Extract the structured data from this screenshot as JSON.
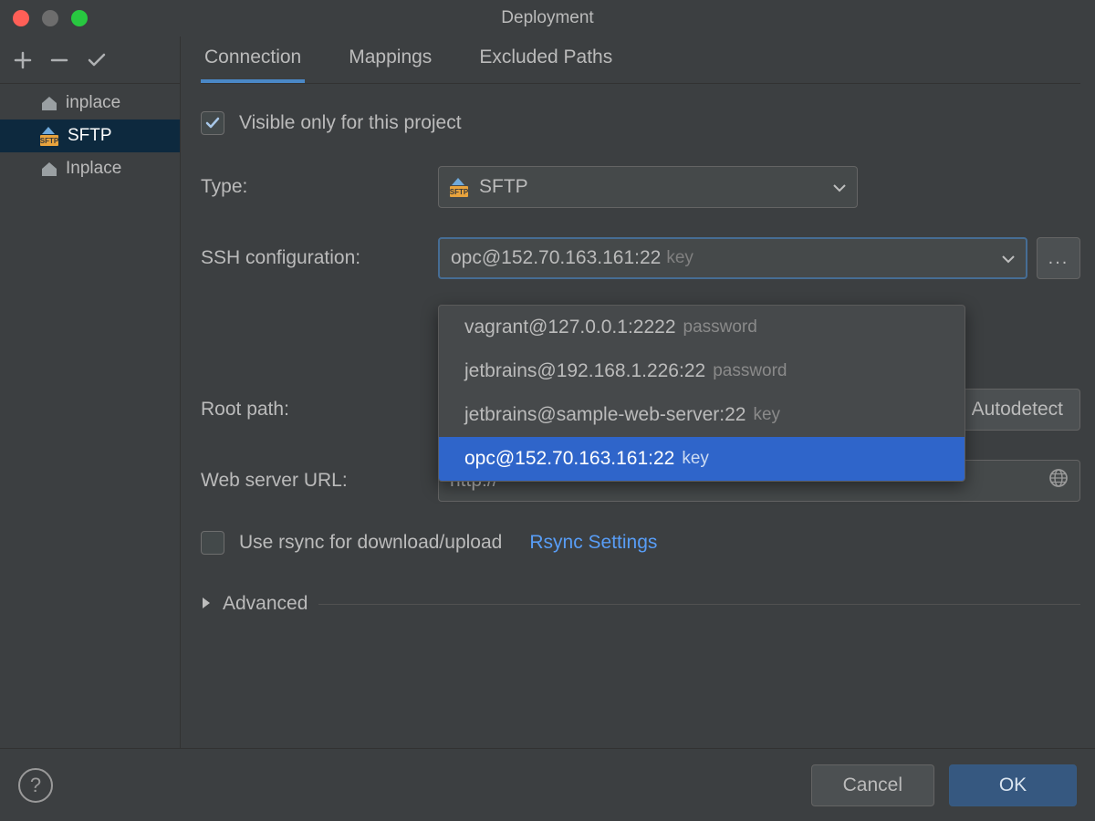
{
  "title": "Deployment",
  "sidebar": {
    "items": [
      {
        "label": "inplace",
        "icon": "home"
      },
      {
        "label": "SFTP",
        "icon": "sftp"
      },
      {
        "label": "Inplace",
        "icon": "home"
      }
    ]
  },
  "tabs": {
    "items": [
      {
        "label": "Connection",
        "active": true
      },
      {
        "label": "Mappings",
        "active": false
      },
      {
        "label": "Excluded Paths",
        "active": false
      }
    ]
  },
  "form": {
    "visible_only_label": "Visible only for this project",
    "type_label": "Type:",
    "type_value": "SFTP",
    "ssh_config_label": "SSH configuration:",
    "ssh_config_value": "opc@152.70.163.161:22",
    "ssh_config_hint": "key",
    "root_path_label": "Root path:",
    "autodetect_label": "Autodetect",
    "web_url_label": "Web server URL:",
    "web_url_value": "http://",
    "rsync_label": "Use rsync for download/upload",
    "rsync_link": "Rsync Settings",
    "advanced_label": "Advanced"
  },
  "dropdown": {
    "items": [
      {
        "host": "vagrant@127.0.0.1:2222",
        "auth": "password",
        "selected": false
      },
      {
        "host": "jetbrains@192.168.1.226:22",
        "auth": "password",
        "selected": false
      },
      {
        "host": "jetbrains@sample-web-server:22",
        "auth": "key",
        "selected": false
      },
      {
        "host": "opc@152.70.163.161:22",
        "auth": "key",
        "selected": true
      }
    ]
  },
  "footer": {
    "cancel": "Cancel",
    "ok": "OK"
  }
}
